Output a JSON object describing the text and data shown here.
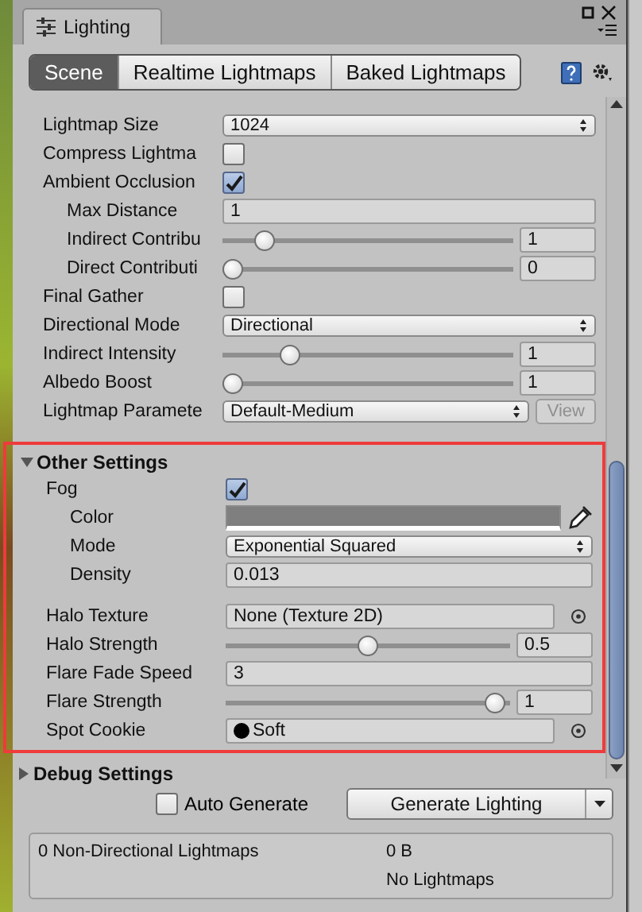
{
  "window": {
    "title": "Lighting"
  },
  "tabs": [
    {
      "label": "Scene",
      "selected": true
    },
    {
      "label": "Realtime Lightmaps",
      "selected": false
    },
    {
      "label": "Baked Lightmaps",
      "selected": false
    }
  ],
  "rows": [
    {
      "kind": "dropdown",
      "label": "Lightmap Size",
      "value": "1024"
    },
    {
      "kind": "checkbox",
      "label": "Compress Lightma",
      "checked": false
    },
    {
      "kind": "checkbox",
      "label": "Ambient Occlusion",
      "checked": true,
      "children": [
        {
          "kind": "field",
          "label": "Max Distance",
          "value": "1"
        },
        {
          "kind": "slider",
          "label": "Indirect Contribu",
          "level": 0.12,
          "value": "1"
        },
        {
          "kind": "slider",
          "label": "Direct Contributi",
          "level": 0,
          "value": "0"
        }
      ]
    },
    {
      "kind": "checkbox",
      "label": "Final Gather",
      "checked": false
    },
    {
      "kind": "dropdown",
      "label": "Directional Mode",
      "value": "Directional"
    },
    {
      "kind": "slider",
      "label": "Indirect Intensity",
      "level": 0.21,
      "value": "1"
    },
    {
      "kind": "slider",
      "label": "Albedo Boost",
      "level": 0,
      "value": "1"
    },
    {
      "kind": "dropdown",
      "label": "Lightmap Paramete",
      "value": "Default-Medium",
      "button": {
        "label": "View",
        "disabled": true
      }
    }
  ],
  "other_settings": {
    "title": "Other Settings",
    "expanded": true,
    "highlighted": true,
    "fog": {
      "kind": "checkbox",
      "label": "Fog",
      "checked": true,
      "children": [
        {
          "kind": "color",
          "label": "Color",
          "color": "#7f7f7f"
        },
        {
          "kind": "dropdown",
          "label": "Mode",
          "value": "Exponential Squared"
        },
        {
          "kind": "field",
          "label": "Density",
          "value": "0.013"
        }
      ]
    },
    "rows": [
      {
        "kind": "object",
        "label": "Halo Texture",
        "value": "None (Texture 2D)",
        "preview": false
      },
      {
        "kind": "slider",
        "label": "Halo Strength",
        "level": 0.5,
        "value": "0.5"
      },
      {
        "kind": "field",
        "label": "Flare Fade Speed",
        "value": "3"
      },
      {
        "kind": "slider",
        "label": "Flare Strength",
        "level": 0.98,
        "value": "1"
      },
      {
        "kind": "object",
        "label": "Spot Cookie",
        "value": "Soft",
        "preview": true
      }
    ]
  },
  "debug_settings": {
    "title": "Debug Settings",
    "expanded": false
  },
  "footer": {
    "auto_generate": {
      "label": "Auto Generate",
      "checked": false
    },
    "generate_button": "Generate Lighting",
    "stats": {
      "lightmaps": "0 Non-Directional Lightmaps",
      "size": "0 B",
      "status": "No Lightmaps"
    }
  }
}
